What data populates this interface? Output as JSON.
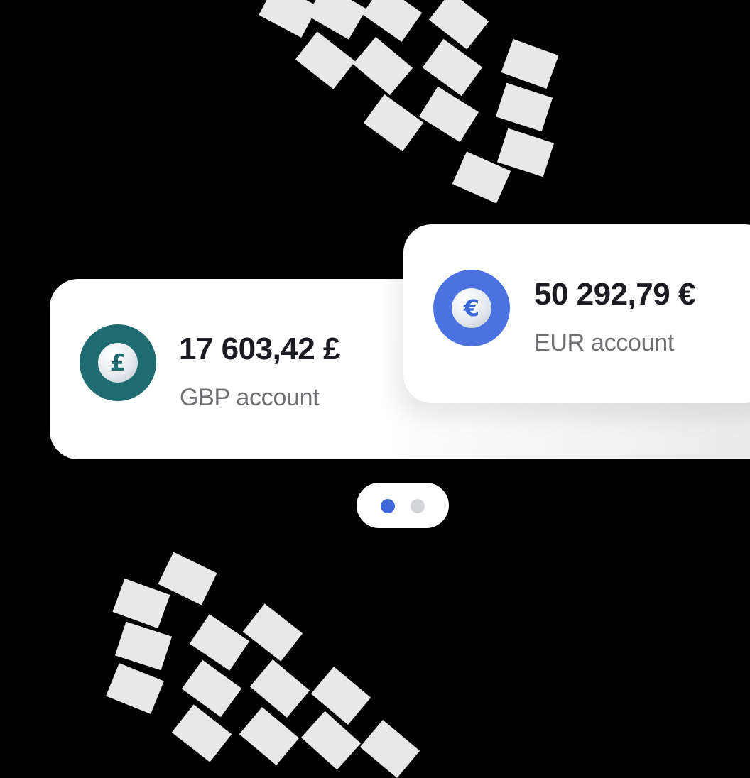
{
  "colors": {
    "background": "#000000",
    "gbp_coin": "#1e6b71",
    "eur_coin": "#4a72e0",
    "dot_active": "#3d66d9",
    "dot_inactive": "#d3d4d8"
  },
  "accounts": [
    {
      "amount": "17 603,42 £",
      "label": "GBP account",
      "symbol": "£",
      "icon": "pound-coin-icon"
    },
    {
      "amount": "50 292,79 €",
      "label": "EUR account",
      "symbol": "€",
      "icon": "euro-coin-icon"
    }
  ],
  "pager": {
    "total": 2,
    "active": 1
  }
}
